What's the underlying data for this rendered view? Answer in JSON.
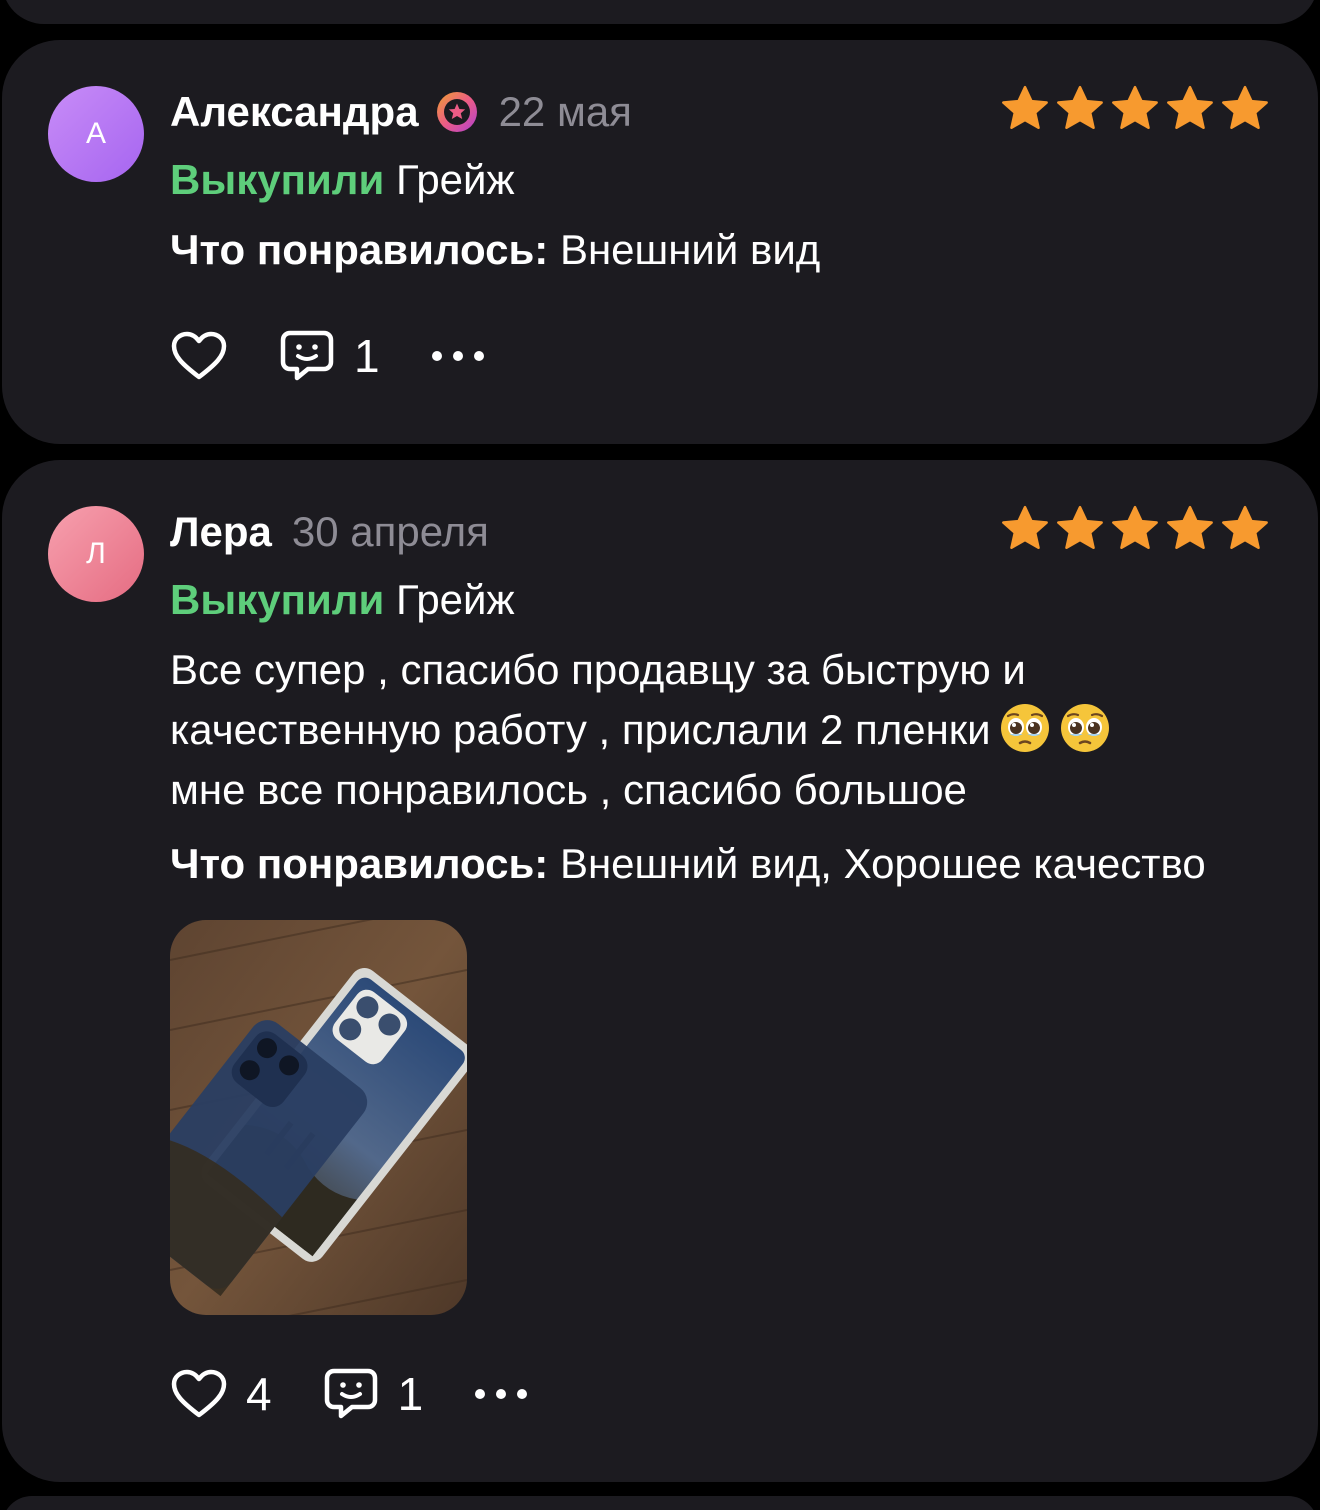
{
  "reviews": [
    {
      "avatar_letter": "А",
      "author": "Александра",
      "date": "22 мая",
      "rating": 5,
      "purchase_label": "Выкупили",
      "product": "Грейж",
      "liked_label": "Что понравилось:",
      "liked_value": "Внешний вид",
      "text": "",
      "likes": "",
      "comments": "1"
    },
    {
      "avatar_letter": "Л",
      "author": "Лера",
      "date": "30 апреля",
      "rating": 5,
      "purchase_label": "Выкупили",
      "product": "Грейж",
      "liked_label": "Что понравилось:",
      "liked_value": "Внешний вид, Хорошее качество",
      "text_lines": [
        "Все супер , спасибо продавцу за быструю и",
        "качественную работу , прислали 2 пленки",
        "мне все понравилось , спасибо большое"
      ],
      "text_emoji": "🥹🥹",
      "likes": "4",
      "comments": "1"
    }
  ],
  "colors": {
    "background": "#000000",
    "card": "#1c1b20",
    "accent_green": "#5ece7b",
    "star": "#f79a2f",
    "muted": "#8e8c95"
  },
  "icons": [
    "heart-icon",
    "comment-icon",
    "more-icon",
    "star-icon",
    "verified-badge-icon"
  ]
}
